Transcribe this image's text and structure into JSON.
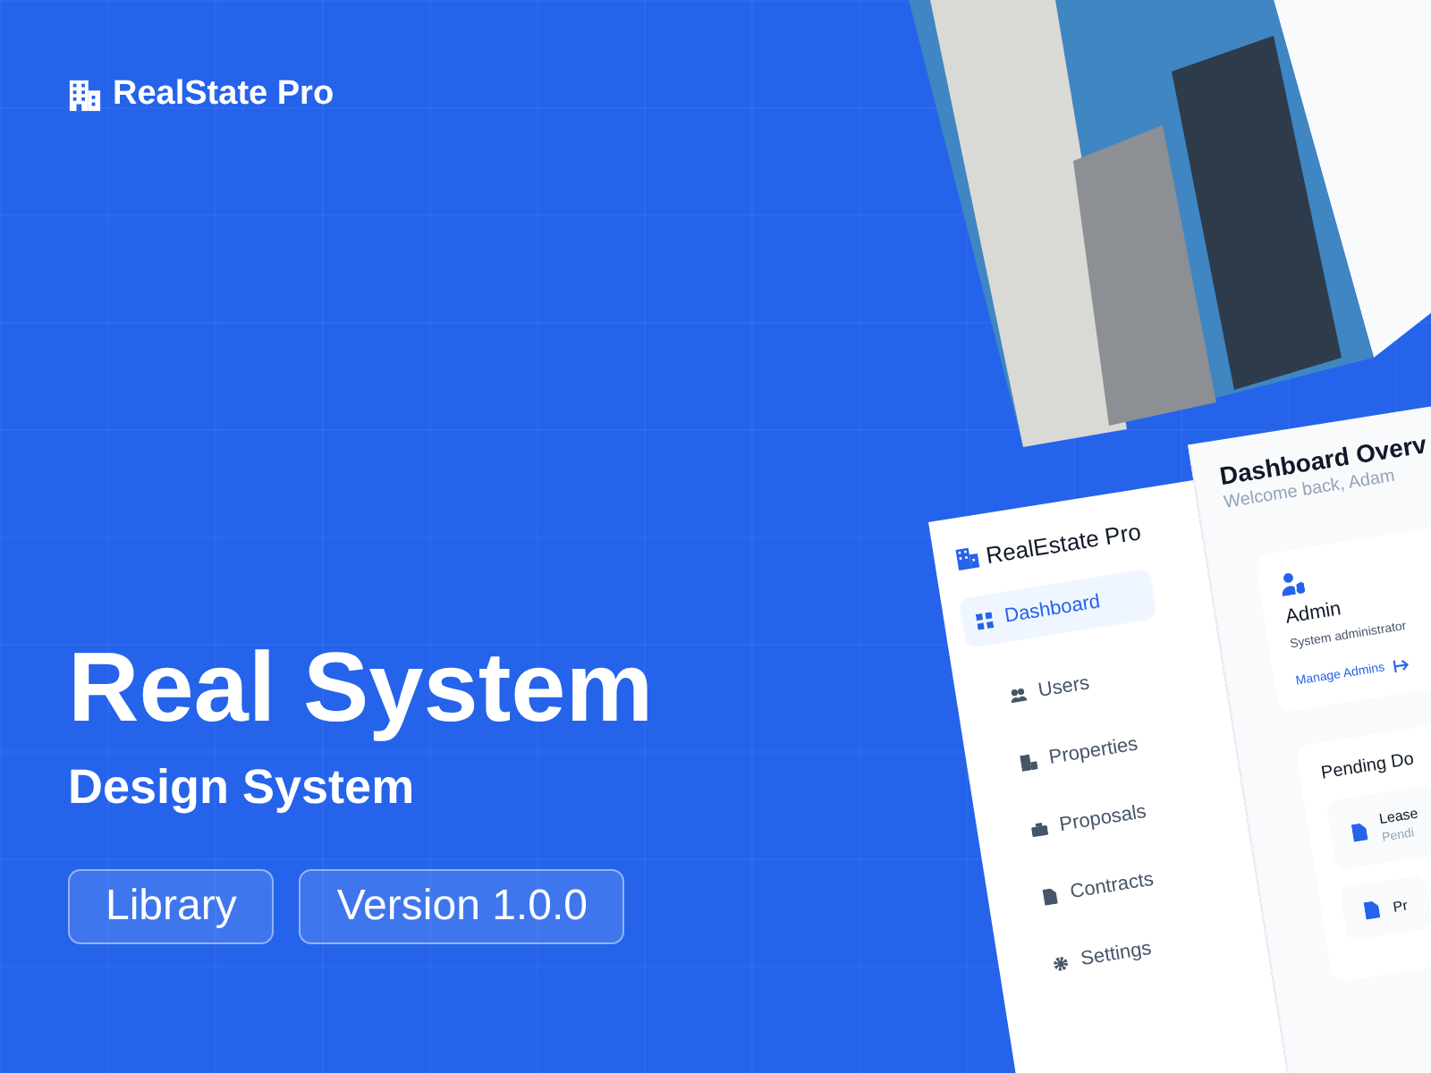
{
  "brand": {
    "name": "RealState Pro"
  },
  "hero": {
    "title": "Real System",
    "subtitle": "Design System"
  },
  "badges": [
    {
      "label": "Library"
    },
    {
      "label": "Version 1.0.0"
    }
  ],
  "mockup": {
    "sidebar": {
      "brand": "RealEstate Pro",
      "items": [
        {
          "label": "Dashboard",
          "kind": "grid",
          "selected": true
        },
        {
          "label": "Users",
          "kind": "users",
          "selected": false
        },
        {
          "label": "Properties",
          "kind": "building",
          "selected": false
        },
        {
          "label": "Proposals",
          "kind": "briefcase",
          "selected": false
        },
        {
          "label": "Contracts",
          "kind": "document",
          "selected": false
        },
        {
          "label": "Settings",
          "kind": "gear",
          "selected": false
        }
      ]
    },
    "header": {
      "title": "Dashboard Overv",
      "subtitle": "Welcome back, Adam"
    },
    "role_card": {
      "title": "Admin",
      "description": "System administrator",
      "link": "Manage Admins"
    },
    "pending": {
      "title": "Pending Do",
      "items": [
        {
          "title": "Lease",
          "status": "Pendi"
        },
        {
          "title": "Pr"
        }
      ]
    }
  }
}
